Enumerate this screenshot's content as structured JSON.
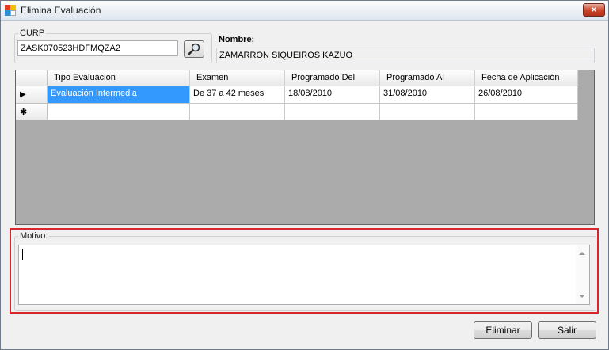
{
  "window": {
    "title": "Elimina Evaluación",
    "close_glyph": "×"
  },
  "curp": {
    "label": "CURP",
    "value": "ZASK070523HDFMQZA2",
    "search_icon": "magnifier-icon"
  },
  "nombre": {
    "label": "Nombre:",
    "value": "ZAMARRON SIQUEIROS KAZUO"
  },
  "grid": {
    "columns": [
      "Tipo Evaluación",
      "Examen",
      "Programado Del",
      "Programado Al",
      "Fecha de Aplicación"
    ],
    "rows": [
      {
        "row_indicator": "▶",
        "cells": [
          "Evaluación Intermedia",
          "De 37 a 42 meses",
          "18/08/2010",
          "31/08/2010",
          "26/08/2010"
        ]
      }
    ],
    "new_row_indicator": "✱"
  },
  "motivo": {
    "label": "Motivo:",
    "value": ""
  },
  "buttons": {
    "eliminar": "Eliminar",
    "salir": "Salir"
  },
  "colors": {
    "highlight_border": "#d8262c",
    "selection": "#3399ff",
    "grid_background": "#ababab"
  }
}
